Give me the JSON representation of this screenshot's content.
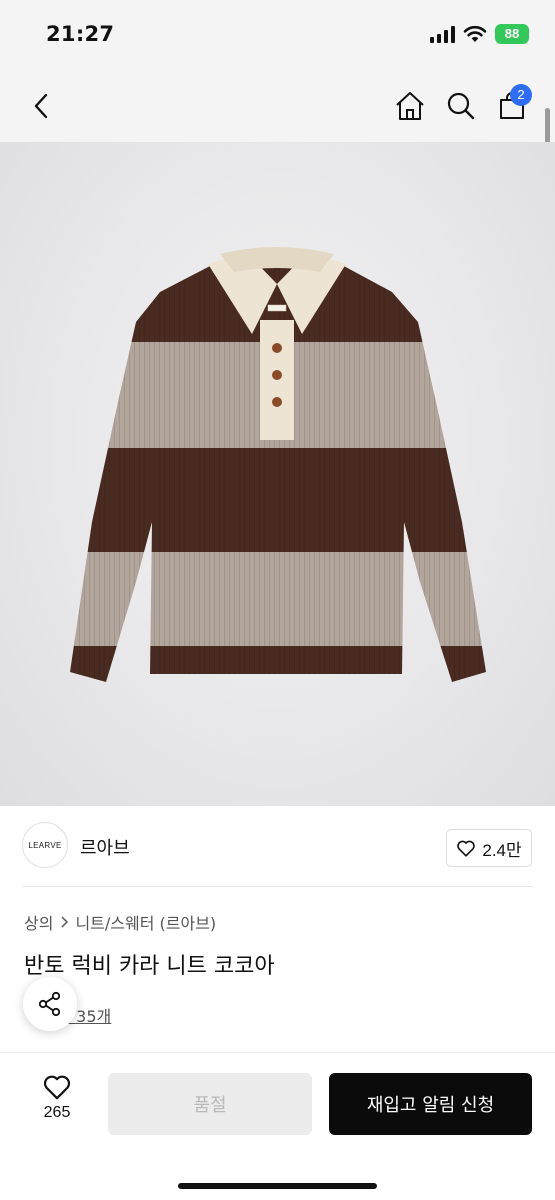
{
  "status_bar": {
    "time": "21:27",
    "battery": "88"
  },
  "header": {
    "back_icon": "chevron-left-icon",
    "home_icon": "home-icon",
    "search_icon": "search-icon",
    "bag_icon": "shopping-bag-icon",
    "bag_count": "2"
  },
  "brand": {
    "logo_text": "LEARVE",
    "name": "르아브",
    "likes": "2.4만"
  },
  "product": {
    "breadcrumb": [
      "상의",
      "니트/스웨터 (르아브)"
    ],
    "title": "반토 럭비 카라 니트 코코아",
    "review_label": "후기 35개",
    "image_colors": {
      "brown": "#4a2b22",
      "beige": "#b2a59c",
      "cream": "#ede4d3"
    }
  },
  "bottom_bar": {
    "wishlist_count": "265",
    "soldout_label": "품절",
    "restock_label": "재입고 알림 신청"
  },
  "colors": {
    "badge": "#2f6df6",
    "primary_button": "#0b0b0b",
    "battery": "#34c759"
  }
}
